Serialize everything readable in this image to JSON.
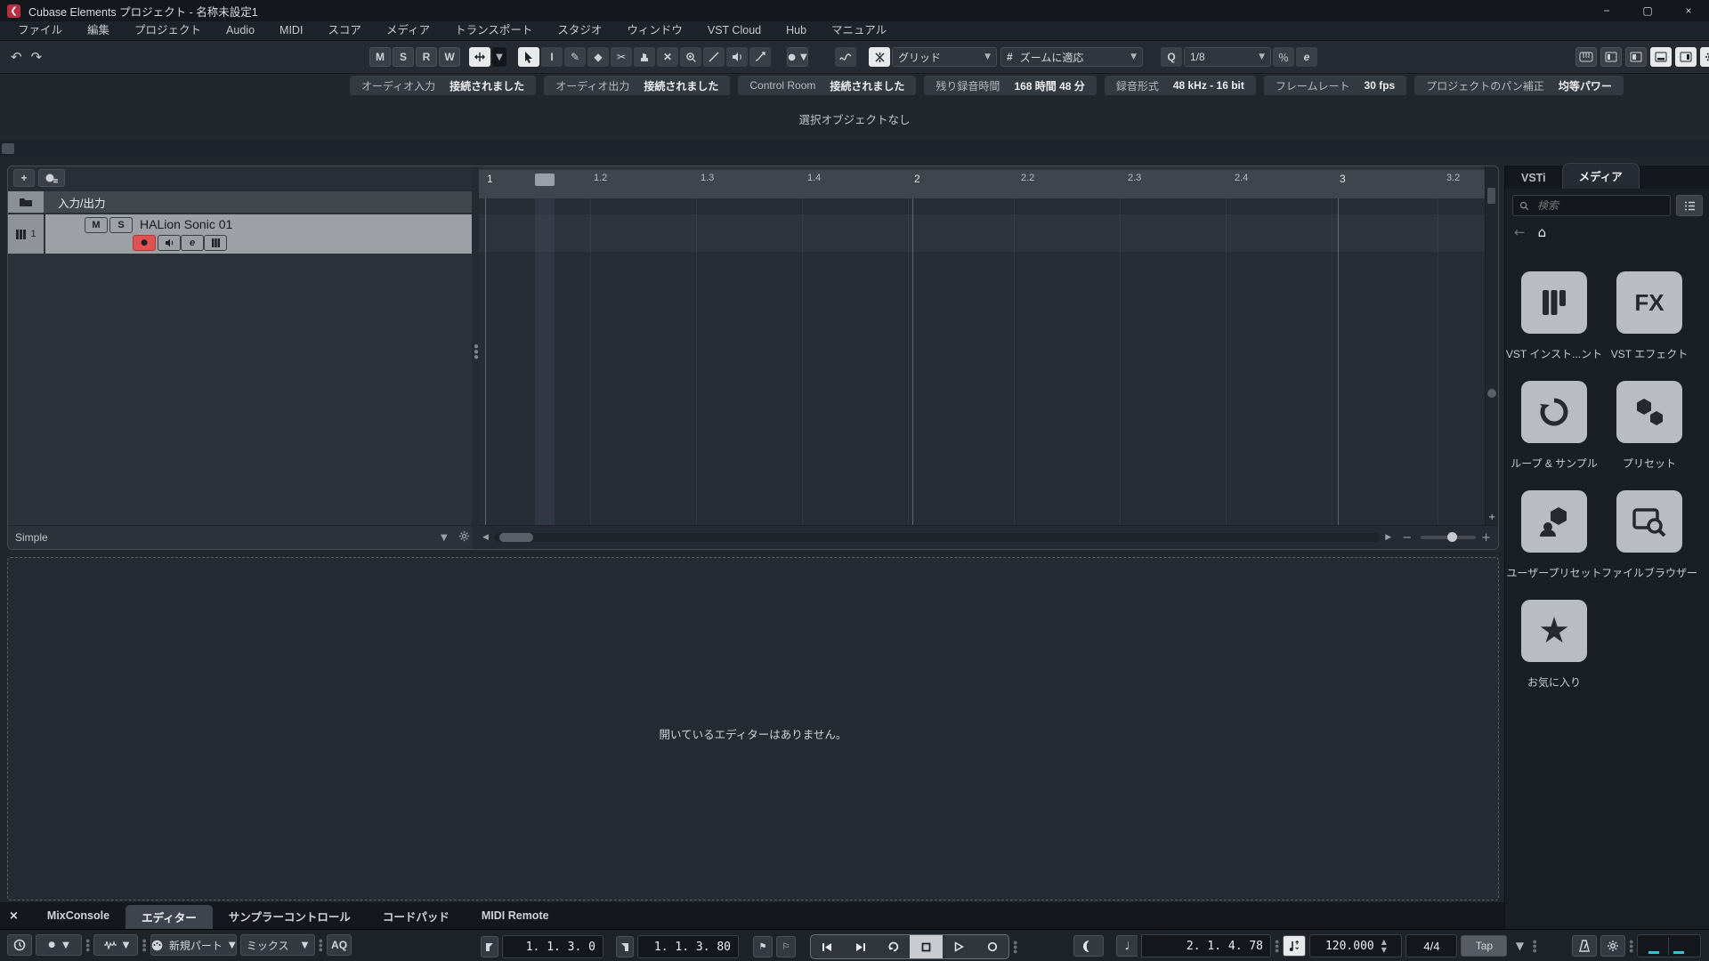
{
  "window": {
    "title": "Cubase Elements プロジェクト - 名称未設定1",
    "minimize": "−",
    "maximize": "▢",
    "close": "×"
  },
  "menubar": {
    "items": [
      "ファイル",
      "編集",
      "プロジェクト",
      "Audio",
      "MIDI",
      "スコア",
      "メディア",
      "トランスポート",
      "スタジオ",
      "ウィンドウ",
      "VST Cloud",
      "Hub",
      "マニュアル"
    ]
  },
  "toolbar": {
    "undo": "↶",
    "redo": "↷",
    "msrw": [
      "M",
      "S",
      "R",
      "W"
    ],
    "snap_grid_label": "グリッド",
    "grid_type_icon": "#",
    "grid_type_label": "ズームに適応",
    "quantize_icon": "Q",
    "quantize_value": "1/8",
    "iterative_quantize_label": "％",
    "quantize_panel_label": "e",
    "range_tool_label": "I",
    "caret": "▼"
  },
  "infoline": {
    "chips": [
      {
        "label": "オーディオ入力",
        "value": "接続されました"
      },
      {
        "label": "オーディオ出力",
        "value": "接続されました"
      },
      {
        "label": "Control Room",
        "value": "接続されました"
      },
      {
        "label": "残り録音時間",
        "value": "168 時間 48 分"
      },
      {
        "label": "録音形式",
        "value": "48 kHz - 16 bit"
      },
      {
        "label": "フレームレート",
        "value": "30 fps"
      },
      {
        "label": "プロジェクトのパン補正",
        "value": "均等パワー"
      }
    ]
  },
  "status_text": "選択オブジェクトなし",
  "project": {
    "io_label": "入力/出力",
    "track": {
      "number": "1",
      "mute": "M",
      "solo": "S",
      "name": "HALion Sonic 01",
      "edit": "e"
    },
    "footer_label": "Simple",
    "ruler_ticks": [
      "1",
      "1.2",
      "1.3",
      "1.4",
      "2",
      "2.2",
      "2.3",
      "2.4",
      "3",
      "3.2"
    ]
  },
  "lower_zone": {
    "message": "開いているエディターはありません。"
  },
  "bottom_tabs": {
    "close": "×",
    "tabs": [
      "MixConsole",
      "エディター",
      "サンプラーコントロール",
      "コードパッド",
      "MIDI Remote"
    ]
  },
  "rack": {
    "tabs": [
      "VSTi",
      "メディア"
    ],
    "search_placeholder": "検索",
    "back": "←",
    "home": "⌂",
    "tiles": [
      {
        "label": "VST インスト...ント"
      },
      {
        "label": "VST エフェクト",
        "glyph": "FX"
      },
      {
        "label": "ループ & サンプル"
      },
      {
        "label": "プリセット"
      },
      {
        "label": "ユーザープリセット"
      },
      {
        "label": "ファイルブラウザー"
      },
      {
        "label": "お気に入り",
        "glyph": "★"
      }
    ]
  },
  "transport": {
    "new_part_label": "新規パート",
    "mix_label": "ミックス",
    "aq_label": "AQ",
    "left_locator": "1. 1. 3.  0",
    "right_locator": "1. 1. 3. 80",
    "position": "2. 1. 4. 78",
    "note_icon": "♩",
    "tempo": "120.000",
    "time_signature": "4/4",
    "tap_label": "Tap"
  }
}
